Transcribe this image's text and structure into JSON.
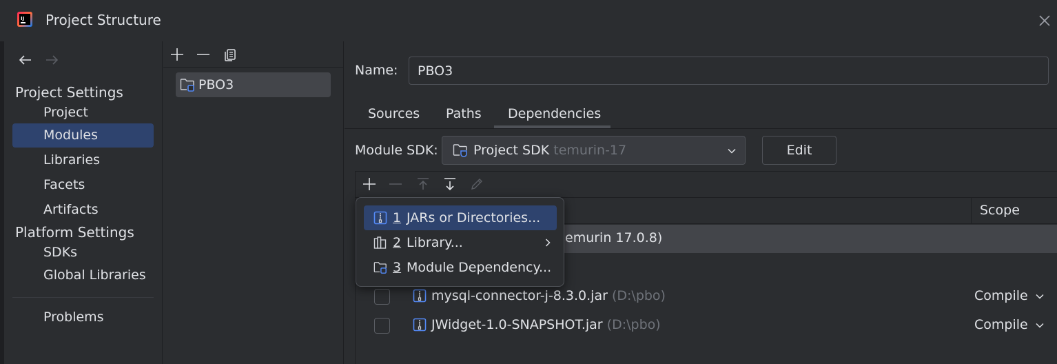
{
  "window": {
    "title": "Project Structure"
  },
  "colors": {
    "accent": "#2e436e",
    "jar_blue": "#548af7",
    "background": "#2b2d30"
  },
  "nav": {
    "project_settings_header": "Project Settings",
    "project_settings_items": [
      "Project",
      "Modules",
      "Libraries",
      "Facets",
      "Artifacts"
    ],
    "selected": "Modules",
    "platform_settings_header": "Platform Settings",
    "platform_settings_items": [
      "SDKs",
      "Global Libraries"
    ],
    "problems": "Problems"
  },
  "modules": {
    "items": [
      "PBO3"
    ]
  },
  "module": {
    "name_label": "Name:",
    "name_value": "PBO3",
    "tabs": [
      "Sources",
      "Paths",
      "Dependencies"
    ],
    "active_tab": "Dependencies",
    "sdk_label": "Module SDK:",
    "sdk_value": "Project SDK",
    "sdk_hint": "temurin-17",
    "edit_label": "Edit"
  },
  "dependencies": {
    "scope_header": "Scope",
    "sdk_row_visible_text": "emurin 17.0.8)",
    "rows": [
      {
        "name": "mysql-connector-j-8.3.0.jar",
        "path": "(D:\\pbo)",
        "scope": "Compile",
        "checked": false
      },
      {
        "name": "JWidget-1.0-SNAPSHOT.jar",
        "path": "(D:\\pbo)",
        "scope": "Compile",
        "checked": false
      }
    ]
  },
  "add_popup": {
    "items": [
      {
        "num": "1",
        "label": "JARs or Directories...",
        "icon": "jar-icon",
        "selected": true
      },
      {
        "num": "2",
        "label": "Library...",
        "icon": "library-icon",
        "has_submenu": true
      },
      {
        "num": "3",
        "label": "Module Dependency...",
        "icon": "module-folder-icon"
      }
    ]
  }
}
